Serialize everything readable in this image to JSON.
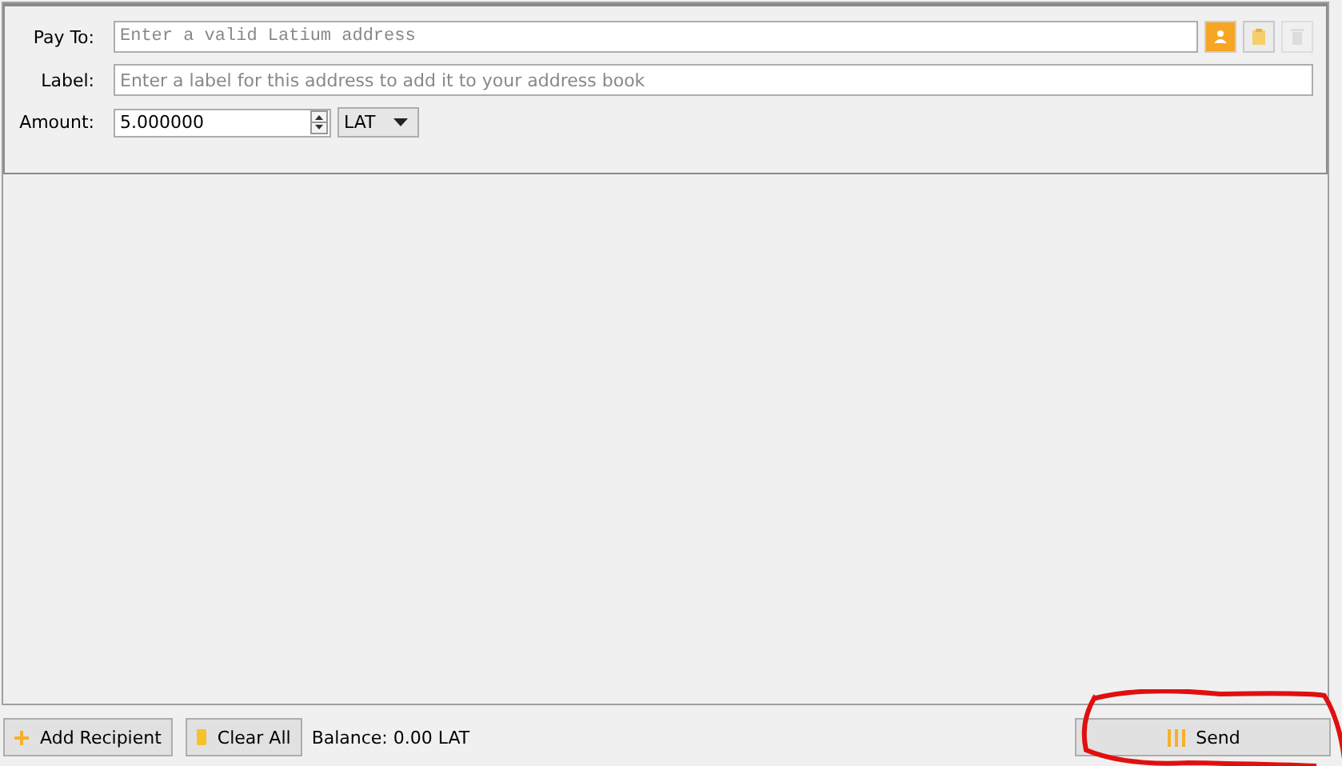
{
  "recipient": {
    "pay_to": {
      "label": "Pay To:",
      "placeholder": "Enter a valid Latium address"
    },
    "label": {
      "label": "Label:",
      "placeholder": "Enter a label for this address to add it to your address book"
    },
    "amount": {
      "label": "Amount:",
      "value": "5.000000",
      "unit": "LAT"
    },
    "address_buttons": [
      {
        "kind": "addressbook",
        "disabled": false
      },
      {
        "kind": "paste",
        "disabled": false
      },
      {
        "kind": "delete",
        "disabled": true
      }
    ]
  },
  "footer": {
    "add_recipient": "Add Recipient",
    "clear_all": "Clear All",
    "balance": "Balance: 0.00 LAT",
    "send": "Send"
  }
}
